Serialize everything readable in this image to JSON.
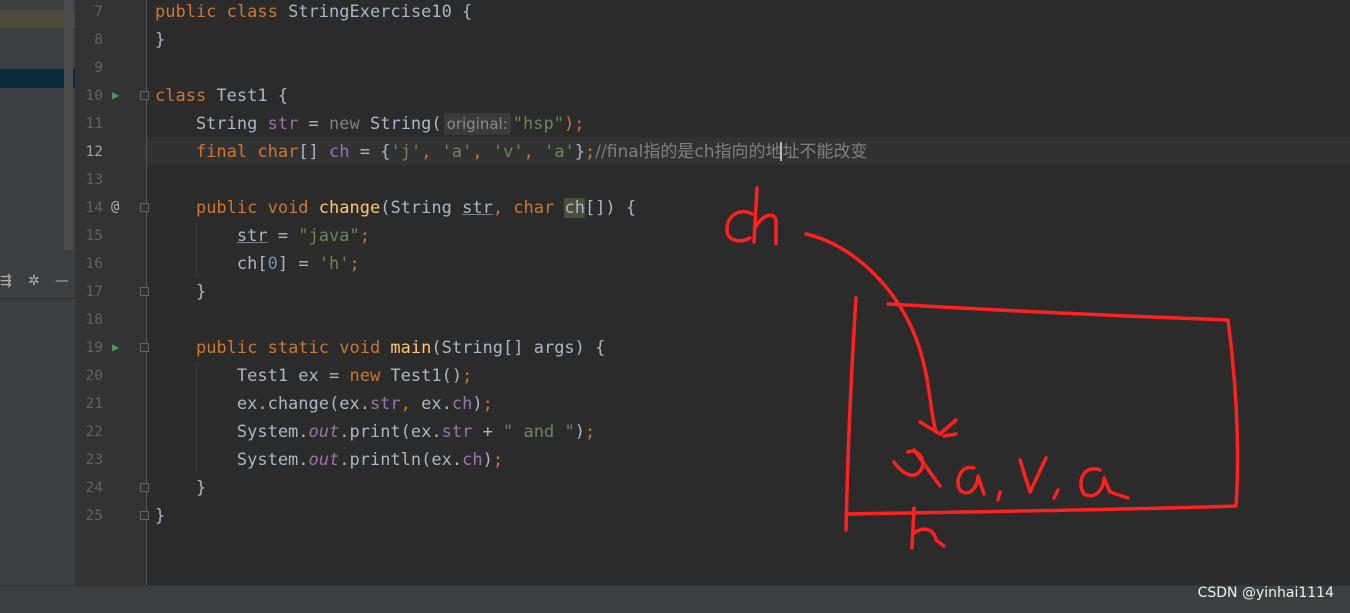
{
  "editor": {
    "lines": [
      {
        "num": "7",
        "text": "public class StringExercise10 {"
      },
      {
        "num": "8",
        "text": "}"
      },
      {
        "num": "9",
        "text": ""
      },
      {
        "num": "10",
        "text": "class Test1 {"
      },
      {
        "num": "11",
        "text": "String str = new String( original: \"hsp\");"
      },
      {
        "num": "12",
        "text": "final char[] ch = {'j', 'a', 'v', 'a'};//final指的是ch指向的地址不能改变"
      },
      {
        "num": "13",
        "text": ""
      },
      {
        "num": "14",
        "text": "public void change(String str, char ch[]) {"
      },
      {
        "num": "15",
        "text": "str = \"java\";"
      },
      {
        "num": "16",
        "text": "ch[0] = 'h';"
      },
      {
        "num": "17",
        "text": "}"
      },
      {
        "num": "18",
        "text": ""
      },
      {
        "num": "19",
        "text": "public static void main(String[] args) {"
      },
      {
        "num": "20",
        "text": "Test1 ex = new Test1();"
      },
      {
        "num": "21",
        "text": "ex.change(ex.str, ex.ch);"
      },
      {
        "num": "22",
        "text": "System.out.print(ex.str + \" and \");"
      },
      {
        "num": "23",
        "text": "System.out.println(ex.ch);"
      },
      {
        "num": "24",
        "text": "}"
      },
      {
        "num": "25",
        "text": "}"
      }
    ],
    "current_line": "12",
    "gutter_marks": {
      "run_lines": [
        "10",
        "19"
      ],
      "override_line": "14",
      "override_symbol": "@"
    },
    "inlay_hint": "original:",
    "comment_text": "//final指的是ch指向的地址不能改变"
  },
  "toolbar_icons": [
    "adjust-icon",
    "gear-icon",
    "minimize-icon"
  ],
  "annotation": {
    "label": "ch",
    "box_content": "j,a,v,a",
    "below_mark": "h",
    "color": "#ff2020"
  },
  "watermark": "CSDN @yinhai1114",
  "colors": {
    "background": "#2b2b2b",
    "keyword": "#cc7832",
    "string": "#6a8759",
    "method": "#ffc66d",
    "field": "#9876aa",
    "comment": "#808080",
    "text": "#a9b7c6"
  }
}
